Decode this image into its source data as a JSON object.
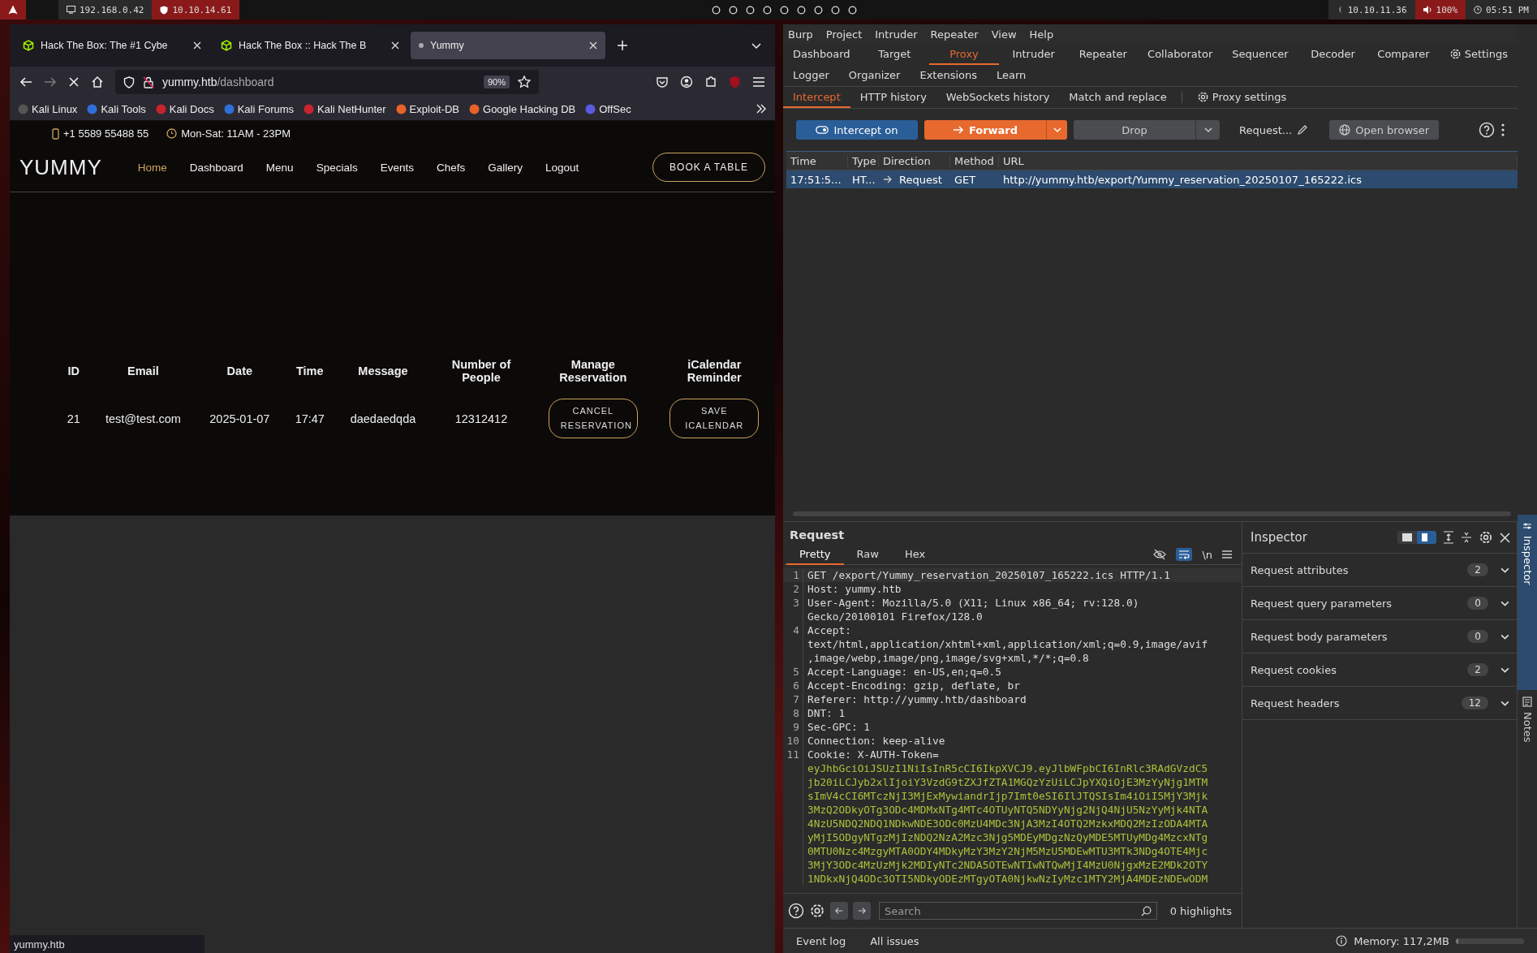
{
  "top_bar": {
    "left": [
      {
        "kind": "monitor",
        "text": "192.168.0.42"
      },
      {
        "kind": "shield",
        "text": "10.10.14.61"
      }
    ],
    "right": [
      {
        "kind": "target",
        "text": "10.10.11.36"
      },
      {
        "kind": "volume",
        "text": "100%"
      },
      {
        "kind": "clock",
        "text": "05:51 PM"
      }
    ]
  },
  "browser": {
    "tabs": [
      {
        "title": "Hack The Box: The #1 Cybe",
        "selected": false,
        "loading": false
      },
      {
        "title": "Hack The Box :: Hack The B",
        "selected": false,
        "loading": false
      },
      {
        "title": "Yummy",
        "selected": true,
        "loading": true
      }
    ],
    "url": {
      "host": "yummy.htb",
      "path": "/dashboard"
    },
    "zoom": "90%",
    "bookmarks": [
      "Kali Linux",
      "Kali Tools",
      "Kali Docs",
      "Kali Forums",
      "Kali NetHunter",
      "Exploit-DB",
      "Google Hacking DB",
      "OffSec"
    ],
    "page": {
      "phone": "+1 5589 55488 55",
      "hours": "Mon-Sat: 11AM - 23PM",
      "logo": "YUMMY",
      "nav": [
        {
          "label": "Home",
          "selected": true
        },
        {
          "label": "Dashboard",
          "selected": false
        },
        {
          "label": "Menu",
          "selected": false
        },
        {
          "label": "Specials",
          "selected": false
        },
        {
          "label": "Events",
          "selected": false
        },
        {
          "label": "Chefs",
          "selected": false
        },
        {
          "label": "Gallery",
          "selected": false
        },
        {
          "label": "Logout",
          "selected": false
        }
      ],
      "book_button": "BOOK A TABLE",
      "table": {
        "columns": [
          "ID",
          "Email",
          "Date",
          "Time",
          "Message",
          "Number of People",
          "Manage Reservation",
          "iCalendar Reminder"
        ],
        "rows": [
          {
            "cells": [
              "21",
              "test@test.com",
              "2025-01-07",
              "17:47",
              "daedaedqda",
              "12312412"
            ],
            "actions": [
              "CANCEL RESERVATION",
              "SAVE ICALENDAR"
            ]
          }
        ]
      }
    },
    "status_url": "yummy.htb"
  },
  "burp": {
    "menu": [
      "Burp",
      "Project",
      "Intruder",
      "Repeater",
      "View",
      "Help"
    ],
    "main_tabs": [
      [
        {
          "label": "Dashboard",
          "selected": false,
          "kind": "tab"
        },
        {
          "label": "Target",
          "selected": false,
          "kind": "tab"
        },
        {
          "label": "Proxy",
          "selected": true,
          "kind": "tab"
        },
        {
          "label": "Intruder",
          "selected": false,
          "kind": "tab"
        },
        {
          "label": "Repeater",
          "selected": false,
          "kind": "tab"
        },
        {
          "label": "Collaborator",
          "selected": false,
          "kind": "tab"
        },
        {
          "label": "Sequencer",
          "selected": false,
          "kind": "tab"
        },
        {
          "label": "Decoder",
          "selected": false,
          "kind": "tab"
        },
        {
          "label": "Comparer",
          "selected": false,
          "kind": "tab"
        },
        {
          "label": "Settings",
          "selected": false,
          "kind": "settings"
        }
      ],
      [
        {
          "label": "Logger",
          "selected": false,
          "kind": "tab"
        },
        {
          "label": "Organizer",
          "selected": false,
          "kind": "tab"
        },
        {
          "label": "Extensions",
          "selected": false,
          "kind": "tab"
        },
        {
          "label": "Learn",
          "selected": false,
          "kind": "tab"
        }
      ]
    ],
    "proxy_tabs": [
      {
        "label": "Intercept",
        "selected": true,
        "kind": "tab"
      },
      {
        "label": "HTTP history",
        "selected": false,
        "kind": "tab"
      },
      {
        "label": "WebSockets history",
        "selected": false,
        "kind": "tab"
      },
      {
        "label": "Match and replace",
        "selected": false,
        "kind": "tab"
      },
      {
        "label": "Proxy settings",
        "selected": false,
        "kind": "settings"
      }
    ],
    "toolbar": {
      "intercept": {
        "label": "Intercept on",
        "on": true
      },
      "forward": "Forward",
      "drop": "Drop",
      "request_label": "Request...",
      "open_browser": "Open browser"
    },
    "history": {
      "columns": [
        "Time",
        "Type",
        "Direction",
        "Method",
        "URL"
      ],
      "rows": [
        {
          "time": "17:51:5...",
          "type": "HT...",
          "direction": "Request",
          "method": "GET",
          "url": "http://yummy.htb/export/Yummy_reservation_20250107_165222.ics",
          "selected": true
        }
      ]
    },
    "request": {
      "title": "Request",
      "tabs": [
        {
          "label": "Pretty",
          "selected": true
        },
        {
          "label": "Raw",
          "selected": false
        },
        {
          "label": "Hex",
          "selected": false
        }
      ],
      "wrap_on": true,
      "newline_toggle": "\\n",
      "lines": [
        {
          "number": "1",
          "rows": [
            {
              "text": "GET /export/Yummy_reservation_20250107_165222.ics HTTP/1.1",
              "kind": "plain"
            }
          ]
        },
        {
          "number": "2",
          "rows": [
            {
              "text": "Host: yummy.htb",
              "kind": "plain"
            }
          ]
        },
        {
          "number": "3",
          "rows": [
            {
              "text": "User-Agent: Mozilla/5.0 (X11; Linux x86_64; rv:128.0)",
              "kind": "plain"
            },
            {
              "text": "Gecko/20100101 Firefox/128.0",
              "kind": "plain"
            }
          ]
        },
        {
          "number": "4",
          "rows": [
            {
              "text": "Accept:",
              "kind": "plain"
            },
            {
              "text": "text/html,application/xhtml+xml,application/xml;q=0.9,image/avif",
              "kind": "plain"
            },
            {
              "text": ",image/webp,image/png,image/svg+xml,*/*;q=0.8",
              "kind": "plain"
            }
          ]
        },
        {
          "number": "5",
          "rows": [
            {
              "text": "Accept-Language: en-US,en;q=0.5",
              "kind": "plain"
            }
          ]
        },
        {
          "number": "6",
          "rows": [
            {
              "text": "Accept-Encoding: gzip, deflate, br",
              "kind": "plain"
            }
          ]
        },
        {
          "number": "7",
          "rows": [
            {
              "text": "Referer: http://yummy.htb/dashboard",
              "kind": "plain"
            }
          ]
        },
        {
          "number": "8",
          "rows": [
            {
              "text": "DNT: 1",
              "kind": "plain"
            }
          ]
        },
        {
          "number": "9",
          "rows": [
            {
              "text": "Sec-GPC: 1",
              "kind": "plain"
            }
          ]
        },
        {
          "number": "10",
          "rows": [
            {
              "text": "Connection: keep-alive",
              "kind": "plain"
            }
          ]
        },
        {
          "number": "11",
          "rows": [
            {
              "text": "Cookie: X-AUTH-Token=",
              "kind": "plain"
            },
            {
              "text": "eyJhbGciOiJSUzI1NiIsInR5cCI6IkpXVCJ9.eyJlbWFpbCI6InRlc3RAdGVzdC5",
              "kind": "token"
            },
            {
              "text": "jb20iLCJyb2xlIjoiY3VzdG9tZXJfZTA1MGQzYzUiLCJpYXQiOjE3MzYyNjg1MTM",
              "kind": "token"
            },
            {
              "text": "sImV4cCI6MTczNjI3MjExMywiandrIjp7Imt0eSI6IlJTQSIsIm4iOiI5MjY3Mjk",
              "kind": "token"
            },
            {
              "text": "3MzQ2ODkyOTg3ODc4MDMxNTg4MTc4OTUyNTQ5NDYyNjg2NjQ4NjU5NzYyMjk4NTA",
              "kind": "token"
            },
            {
              "text": "4NzU5NDQ2NDQ1NDkwNDE3ODc0MzU4MDc3NjA3MzI4OTQ2MzkxMDQ2MzIzODA4MTA",
              "kind": "token"
            },
            {
              "text": "yMjI5ODgyNTgzMjIzNDQ2NzA2Mzc3Njg5MDEyMDgzNzQyMDE5MTUyMDg4MzcxNTg",
              "kind": "token"
            },
            {
              "text": "0MTU0Nzc4MzgyMTA0ODY4MDkyMzY3MzY2NjM5MzU5MDEwMTU3MTk3NDg4OTE4Mjc",
              "kind": "token"
            },
            {
              "text": "3MjY3ODc4MzUzMjk2MDIyNTc2NDA5OTEwNTIwNTQwMjI4MzU0NjgxMzE2MDk2OTY",
              "kind": "token"
            },
            {
              "text": "1NDkxNjQ4ODc3OTI5NDkyODEzMTgyOTA0NjkwNzIyMzc1MTY2MjA4MDEzNDEwODM",
              "kind": "token"
            }
          ]
        }
      ],
      "search": {
        "placeholder": "Search"
      },
      "highlights": "0 highlights"
    },
    "inspector": {
      "title": "Inspector",
      "layouts": [
        {
          "selected": false
        },
        {
          "selected": true
        }
      ],
      "sections": [
        {
          "label": "Request attributes",
          "count": "2"
        },
        {
          "label": "Request query parameters",
          "count": "0"
        },
        {
          "label": "Request body parameters",
          "count": "0"
        },
        {
          "label": "Request cookies",
          "count": "2"
        },
        {
          "label": "Request headers",
          "count": "12"
        }
      ]
    },
    "side_tabs": [
      {
        "label": "Inspector",
        "selected": true
      },
      {
        "label": "Notes",
        "selected": false
      }
    ],
    "bottom": {
      "links": [
        "Event log",
        "All issues"
      ],
      "memory": "Memory: 117,2MB",
      "level": 0.03
    }
  }
}
